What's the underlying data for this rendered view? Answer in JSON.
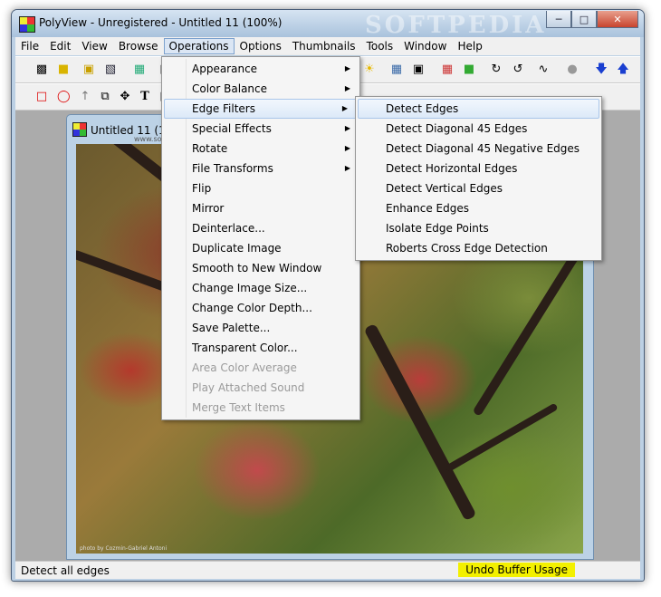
{
  "window": {
    "title": "PolyView - Unregistered - Untitled 11 (100%)",
    "watermark": "SOFTPEDIA"
  },
  "menubar": [
    "File",
    "Edit",
    "View",
    "Browse",
    "Operations",
    "Options",
    "Thumbnails",
    "Tools",
    "Window",
    "Help"
  ],
  "child": {
    "title": "Untitled 11 (10",
    "watermark": "www.softpedia.com",
    "credit": "photo by Cozmin-Gabriel Antoni"
  },
  "operations_menu": [
    {
      "label": "Appearance",
      "submenu": true,
      "disabled": false
    },
    {
      "label": "Color Balance",
      "submenu": true,
      "disabled": false
    },
    {
      "label": "Edge Filters",
      "submenu": true,
      "disabled": false,
      "highlighted": true
    },
    {
      "label": "Special Effects",
      "submenu": true,
      "disabled": false
    },
    {
      "label": "Rotate",
      "submenu": true,
      "disabled": false
    },
    {
      "label": "File Transforms",
      "submenu": true,
      "disabled": false
    },
    {
      "label": "Flip",
      "submenu": false,
      "disabled": false
    },
    {
      "label": "Mirror",
      "submenu": false,
      "disabled": false
    },
    {
      "label": "Deinterlace...",
      "submenu": false,
      "disabled": false
    },
    {
      "label": "Duplicate Image",
      "submenu": false,
      "disabled": false
    },
    {
      "label": "Smooth to New Window",
      "submenu": false,
      "disabled": false
    },
    {
      "label": "Change Image Size...",
      "submenu": false,
      "disabled": false
    },
    {
      "label": "Change Color Depth...",
      "submenu": false,
      "disabled": false
    },
    {
      "label": "Save Palette...",
      "submenu": false,
      "disabled": false
    },
    {
      "label": "Transparent Color...",
      "submenu": false,
      "disabled": false
    },
    {
      "label": "Area Color Average",
      "submenu": false,
      "disabled": true
    },
    {
      "label": "Play Attached Sound",
      "submenu": false,
      "disabled": true
    },
    {
      "label": "Merge Text Items",
      "submenu": false,
      "disabled": true
    }
  ],
  "edge_filters_menu": [
    {
      "label": "Detect Edges",
      "highlighted": true
    },
    {
      "label": "Detect Diagonal 45 Edges"
    },
    {
      "label": "Detect Diagonal 45 Negative Edges"
    },
    {
      "label": "Detect Horizontal Edges"
    },
    {
      "label": "Detect Vertical Edges"
    },
    {
      "label": "Enhance Edges"
    },
    {
      "label": "Isolate Edge Points"
    },
    {
      "label": "Roberts Cross Edge Detection"
    }
  ],
  "status": {
    "text": "Detect all edges",
    "undo": "Undo Buffer Usage"
  },
  "toolbar1_icons": [
    "open-image-icon",
    "new-folder-icon",
    "open-icon",
    "save-icon",
    "image-icon",
    "sun-icon",
    "grid-icon",
    "frame-icon",
    "color-grid-icon",
    "green-grid-icon",
    "rotate-cw-icon",
    "rotate-ccw-icon",
    "waveform-icon",
    "stop-icon",
    "arrow-down-icon",
    "arrow-up-icon"
  ],
  "toolbar2_icons": [
    "rect-select-icon",
    "lasso-icon",
    "arrow-icon",
    "crop-icon",
    "move-icon",
    "text-icon"
  ]
}
